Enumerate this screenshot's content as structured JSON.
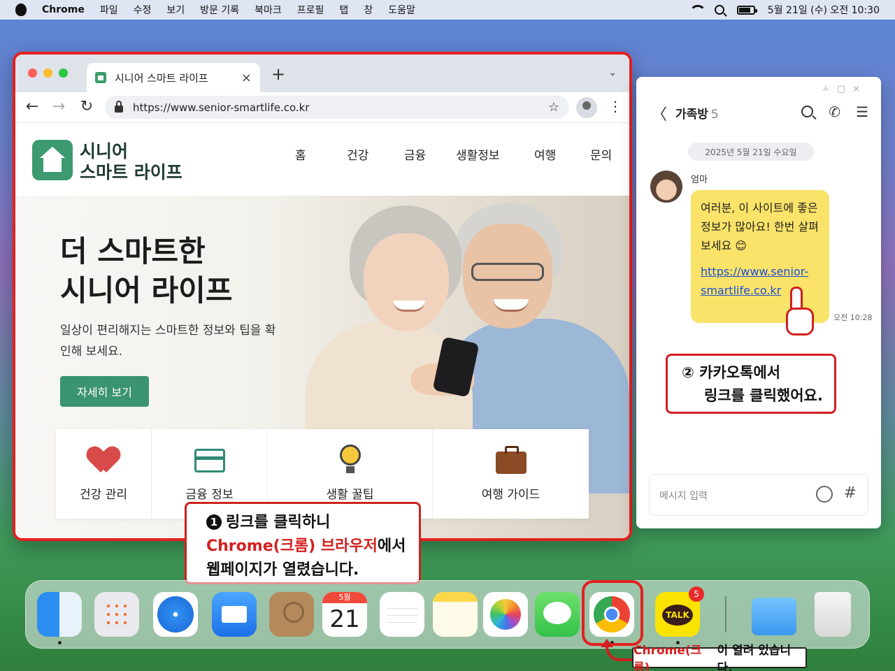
{
  "menubar": {
    "app_name": "Chrome",
    "menus": [
      "파일",
      "수정",
      "보기",
      "방문 기록",
      "북마크",
      "프로필",
      "탭",
      "창",
      "도움말"
    ],
    "clock": "5월 21일 (수) 오전 10:30"
  },
  "browser": {
    "tab_title": "시니어 스마트 라이프",
    "tab_close": "×",
    "new_tab": "+",
    "url": "https://www.senior-smartlife.co.kr",
    "back": "←",
    "forward": "→",
    "reload": "↻",
    "bookmark_star": "☆",
    "menu": "⋮",
    "tab_dropdown": "⌄"
  },
  "site": {
    "logo_line1": "시니어",
    "logo_line2": "스마트 라이프",
    "nav": [
      "홈",
      "건강",
      "금융",
      "생활정보",
      "여행",
      "문의"
    ],
    "hero_title_line1": "더 스마트한",
    "hero_title_line2": "시니어 라이프",
    "hero_desc": "일상이 편리해지는 스마트한 정보와 팁을 확인해 보세요.",
    "cta": "자세히 보기",
    "cards": [
      "건강 관리",
      "금융 정보",
      "생활 꿀팁",
      "여행 가이드"
    ]
  },
  "callout1": {
    "num": "1",
    "line1": "링크를 클릭하니",
    "line2_red": "Chrome(크롬) 브라우저",
    "line2_rest": "에서",
    "line3": "웹페이지가 열렸습니다."
  },
  "kakao": {
    "window_buttons": "ㅅ□×",
    "back": "〈",
    "room_title": "가족방",
    "member_count": "5",
    "call_icon": "✆",
    "menu_icon": "☰",
    "date": "2025년 5월 21일 수요일",
    "sender": "엄마",
    "message": "여러분, 이 사이트에 좋은 정보가 많아요! 한번 살펴보세요 😊",
    "link": "https://www.senior-smartlife.co.kr",
    "time": "오전 10:28",
    "input_placeholder": "메시지 입력",
    "hash": "#"
  },
  "callout2": {
    "num": "②",
    "line1": "카카오톡에서",
    "line2": "링크를 클릭했어요."
  },
  "dock": {
    "calendar_month": "5월",
    "calendar_day": "21",
    "kakao_label": "TALK",
    "kakao_badge": "5"
  },
  "chrome_note": {
    "red": "Chrome(크롬)",
    "rest": "이 열려 있습니다."
  },
  "colors": {
    "highlight_red": "#e32020",
    "brand_green": "#3b9470",
    "kakao_yellow": "#fae368"
  }
}
